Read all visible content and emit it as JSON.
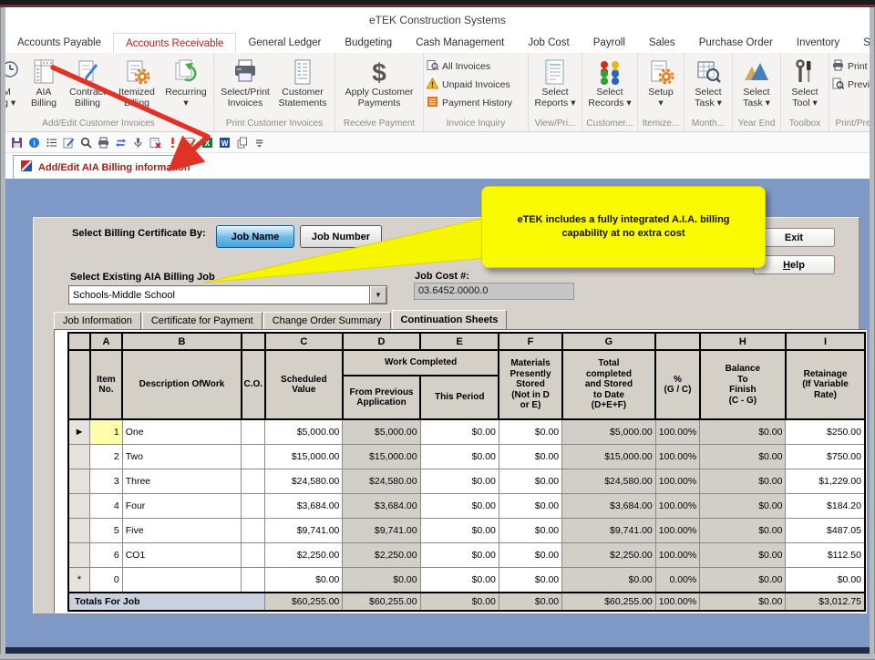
{
  "window": {
    "title": "eTEK Construction Systems"
  },
  "menu": {
    "items": [
      {
        "label": "Accounts Payable",
        "active": false
      },
      {
        "label": "Accounts Receivable",
        "active": true
      },
      {
        "label": "General Ledger",
        "active": false
      },
      {
        "label": "Budgeting",
        "active": false
      },
      {
        "label": "Cash Management",
        "active": false
      },
      {
        "label": "Job Cost",
        "active": false
      },
      {
        "label": "Payroll",
        "active": false
      },
      {
        "label": "Sales",
        "active": false
      },
      {
        "label": "Purchase Order",
        "active": false
      },
      {
        "label": "Inventory",
        "active": false
      },
      {
        "label": "System Ut",
        "active": false
      }
    ]
  },
  "ribbon": {
    "groups": [
      {
        "label": "Add/Edit Customer Invoices",
        "items": [
          {
            "icon": "clock-billing-icon",
            "label1": "/M",
            "label2": "ing ▾"
          },
          {
            "icon": "ruler-grid-icon",
            "label1": "AIA",
            "label2": "Billing"
          },
          {
            "icon": "contract-pen-icon",
            "label1": "Contract",
            "label2": "Billing"
          },
          {
            "icon": "page-gear-icon",
            "label1": "Itemized",
            "label2": "Billing"
          },
          {
            "icon": "recurring-pages-icon",
            "label1": "Recurring",
            "label2": "▾"
          }
        ]
      },
      {
        "label": "Print Customer Invoices",
        "items": [
          {
            "icon": "printer-icon",
            "label1": "Select/Print",
            "label2": "Invoices"
          },
          {
            "icon": "statement-icon",
            "label1": "Customer",
            "label2": "Statements"
          }
        ]
      },
      {
        "label": "Receive Payment",
        "items": [
          {
            "icon": "dollar-icon",
            "label1": "Apply Customer",
            "label2": "Payments"
          }
        ]
      },
      {
        "label": "Invoice Inquiry",
        "small_items": [
          {
            "icon": "all-invoices-icon",
            "label": "All Invoices"
          },
          {
            "icon": "warning-icon",
            "label": "Unpaid Invoices"
          },
          {
            "icon": "history-icon",
            "label": "Payment History"
          }
        ]
      },
      {
        "label": "View/Pri...",
        "items": [
          {
            "icon": "report-icon",
            "label1": "Select",
            "label2": "Reports ▾"
          }
        ]
      },
      {
        "label": "Customer...",
        "items": [
          {
            "icon": "people-icon",
            "label1": "Select",
            "label2": "Records ▾"
          }
        ]
      },
      {
        "label": "Itemize...",
        "items": [
          {
            "icon": "setup-gear-icon",
            "label1": "Setup",
            "label2": "▾"
          }
        ]
      },
      {
        "label": "Month...",
        "items": [
          {
            "icon": "grid-search-icon",
            "label1": "Select",
            "label2": "Task ▾"
          }
        ]
      },
      {
        "label": "Year End",
        "items": [
          {
            "icon": "chart-mountain-icon",
            "label1": "Select",
            "label2": "Task ▾"
          }
        ]
      },
      {
        "label": "Toolbox",
        "items": [
          {
            "icon": "tools-icon",
            "label1": "Select",
            "label2": "Tool ▾"
          }
        ]
      },
      {
        "label": "Print/Preview",
        "small_items": [
          {
            "icon": "printer-small-icon",
            "label": "Print"
          },
          {
            "icon": "preview-icon",
            "label": "Preview"
          }
        ]
      }
    ]
  },
  "quickbar": {
    "icons": [
      "save",
      "info",
      "list",
      "edit",
      "search",
      "print",
      "sync",
      "audit",
      "close-form",
      "alert",
      "find-form",
      "export-excel",
      "export-word",
      "copy",
      "overflow"
    ]
  },
  "doc_tab": {
    "label": "Add/Edit AIA Billing information"
  },
  "callout": {
    "line1": "eTEK includes a fully integrated A.I.A. billing",
    "line2": "capability at no extra cost"
  },
  "form": {
    "cert_by_label": "Select Billing Certificate By:",
    "job_name_btn": "Job Name",
    "job_number_btn": "Job Number",
    "exit_btn": "Exit",
    "help_u": "H",
    "help_rest": "elp",
    "existing_job_label": "Select Existing AIA Billing Job",
    "existing_job_value": "Schools-Middle School",
    "job_cost_label": "Job Cost #:",
    "job_cost_value": "03.6452.0000.0",
    "tabs": [
      {
        "label": "Job Information",
        "active": false
      },
      {
        "label": "Certificate for Payment",
        "active": false
      },
      {
        "label": "Change Order Summary",
        "active": false
      },
      {
        "label": "Continuation Sheets",
        "active": true
      }
    ]
  },
  "grid": {
    "letters": [
      "",
      "A",
      "B",
      "",
      "C",
      "D",
      "E",
      "F",
      "G",
      "",
      "H",
      "I"
    ],
    "header": {
      "item": "Item\nNo.",
      "desc": "Description OfWork",
      "co": "C.O.",
      "c": "Scheduled\nValue",
      "work_completed": "Work Completed",
      "d": "From Previous\nApplication",
      "e": "This Period",
      "f": "Materials\nPresently\nStored\n(Not in D\nor E)",
      "g": "Total\ncompleted\nand Stored\nto Date\n(D+E+F)",
      "pct": "%\n(G / C)",
      "h": "Balance\nTo\nFinish\n(C - G)",
      "i": "Retainage\n(If Variable\nRate)"
    },
    "rows": [
      {
        "sel": "►",
        "item": "1",
        "desc": "One",
        "co": "",
        "c": "$5,000.00",
        "d": "$5,000.00",
        "e": "$0.00",
        "f": "$0.00",
        "g": "$5,000.00",
        "pct": "100.00%",
        "h": "$0.00",
        "i": "$250.00"
      },
      {
        "sel": "",
        "item": "2",
        "desc": "Two",
        "co": "",
        "c": "$15,000.00",
        "d": "$15,000.00",
        "e": "$0.00",
        "f": "$0.00",
        "g": "$15,000.00",
        "pct": "100.00%",
        "h": "$0.00",
        "i": "$750.00"
      },
      {
        "sel": "",
        "item": "3",
        "desc": "Three",
        "co": "",
        "c": "$24,580.00",
        "d": "$24,580.00",
        "e": "$0.00",
        "f": "$0.00",
        "g": "$24,580.00",
        "pct": "100.00%",
        "h": "$0.00",
        "i": "$1,229.00"
      },
      {
        "sel": "",
        "item": "4",
        "desc": "Four",
        "co": "",
        "c": "$3,684.00",
        "d": "$3,684.00",
        "e": "$0.00",
        "f": "$0.00",
        "g": "$3,684.00",
        "pct": "100.00%",
        "h": "$0.00",
        "i": "$184.20"
      },
      {
        "sel": "",
        "item": "5",
        "desc": "Five",
        "co": "",
        "c": "$9,741.00",
        "d": "$9,741.00",
        "e": "$0.00",
        "f": "$0.00",
        "g": "$9,741.00",
        "pct": "100.00%",
        "h": "$0.00",
        "i": "$487.05"
      },
      {
        "sel": "",
        "item": "6",
        "desc": "CO1",
        "co": "",
        "c": "$2,250.00",
        "d": "$2,250.00",
        "e": "$0.00",
        "f": "$0.00",
        "g": "$2,250.00",
        "pct": "100.00%",
        "h": "$0.00",
        "i": "$112.50"
      },
      {
        "sel": "*",
        "item": "0",
        "desc": "",
        "co": "",
        "c": "$0.00",
        "d": "$0.00",
        "e": "$0.00",
        "f": "$0.00",
        "g": "$0.00",
        "pct": "0.00%",
        "h": "$0.00",
        "i": "$0.00"
      }
    ],
    "totals": {
      "label": "Totals For Job",
      "c": "$60,255.00",
      "d": "$60,255.00",
      "e": "$0.00",
      "f": "$0.00",
      "g": "$60,255.00",
      "pct": "100.00%",
      "h": "$0.00",
      "i": "$3,012.75"
    }
  },
  "colors": {
    "desktop_blue": "#7e99c6",
    "panel_grey": "#d6d2cb",
    "header_grey": "#d4d0c8",
    "selected_cell_yellow": "#feffa8",
    "callout_yellow": "#fbfb00",
    "arrow_red": "#e03226",
    "doc_tab_red": "#a02018"
  }
}
